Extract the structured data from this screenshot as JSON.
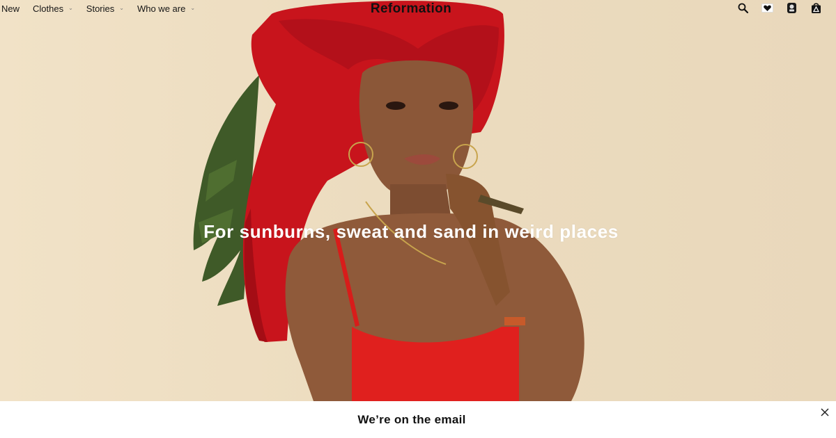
{
  "brand": "Reformation",
  "nav": {
    "items": [
      {
        "label": "New",
        "has_dropdown": false
      },
      {
        "label": "Clothes",
        "has_dropdown": true
      },
      {
        "label": "Stories",
        "has_dropdown": true
      },
      {
        "label": "Who we are",
        "has_dropdown": true
      }
    ],
    "dropdown_glyph": "⌄",
    "right_icons": [
      "search-icon",
      "wishlist-heart-icon",
      "account-icon",
      "shopping-bag-icon"
    ]
  },
  "hero": {
    "headline": "For sunburns, sweat and sand in weird places",
    "colors": {
      "background": "#ecdcbf",
      "towel": "#c8141c",
      "swimsuit": "#e0201e",
      "leaf": "#3f5a28"
    }
  },
  "email_bar": {
    "title": "We’re on the email",
    "close_icon": "close-icon"
  }
}
